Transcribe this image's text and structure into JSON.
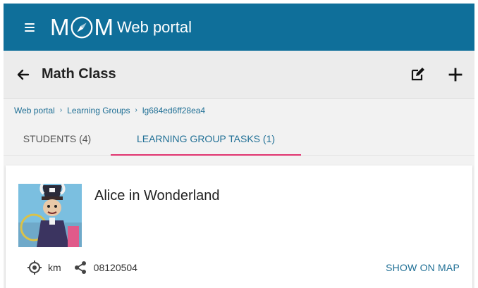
{
  "app": {
    "logo_left": "M",
    "logo_right": "M",
    "name": "Web portal"
  },
  "toolbar": {
    "title": "Math Class"
  },
  "breadcrumb": {
    "items": [
      "Web portal",
      "Learning Groups",
      "lg684ed6ff28ea4"
    ],
    "separator": "›"
  },
  "tabs": [
    {
      "label": "STUDENTS (4)",
      "active": false
    },
    {
      "label": "LEARNING GROUP TASKS (1)",
      "active": true
    }
  ],
  "task": {
    "title": "Alice in Wonderland",
    "distance_unit": "km",
    "code": "08120504",
    "show_map_label": "SHOW ON MAP"
  },
  "colors": {
    "appbar": "#0f6f9a",
    "link": "#1f6f95",
    "tab_indicator": "#e0336f"
  },
  "icons": {
    "menu": "menu-icon",
    "back": "arrow-left-icon",
    "edit": "edit-icon",
    "add": "plus-icon",
    "location": "crosshair-location-icon",
    "share": "share-icon"
  }
}
